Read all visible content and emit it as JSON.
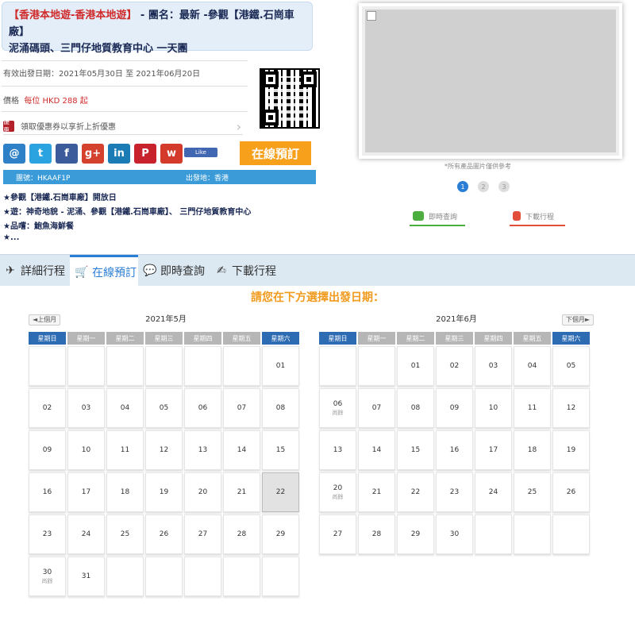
{
  "title": {
    "line1_hl": "【香港本地遊-香港本地遊】",
    "line1_rest": " - 團名：最新 -參觀【港鐵.石崗車廠】",
    "line2": "泥涌碼頭、三門仔地質教育中心 一天團"
  },
  "info": {
    "valid_period": "有效出發日期：2021年05月30日 至 2021年06月20日",
    "price_label": "價格",
    "price_value": "每位 HKD 288 起",
    "coupon_badge": "優惠",
    "coupon_text": "領取優惠券以享折上折優惠"
  },
  "share": {
    "buttons": [
      {
        "name": "email-share-icon",
        "glyph": "@",
        "color": "#2e80c7"
      },
      {
        "name": "twitter-share-icon",
        "glyph": "t",
        "color": "#2aa3e0"
      },
      {
        "name": "facebook-share-icon",
        "glyph": "f",
        "color": "#3b5b9b"
      },
      {
        "name": "googleplus-share-icon",
        "glyph": "g+",
        "color": "#d4422e"
      },
      {
        "name": "linkedin-share-icon",
        "glyph": "in",
        "color": "#1a7bb5"
      },
      {
        "name": "pinterest-share-icon",
        "glyph": "P",
        "color": "#c8232c"
      },
      {
        "name": "weibo-share-icon",
        "glyph": "w",
        "color": "#d33a2c"
      }
    ],
    "like_label": "Like"
  },
  "book_button": "在線預訂",
  "code_bar": {
    "code": "團號：HKAAF1P",
    "departure": "出發地：香港"
  },
  "features": [
    "★參觀【港鐵.石崗車廠】開放日",
    "★遊：神奇地貌 - 泥涌、參觀【港鐵.石崗車廠】、 三門仔地質教育中心",
    "★品嚐：鮑魚海鮮餐",
    "★..."
  ],
  "image_note": "*所有產品圖片僅供參考",
  "carousel_dots": [
    "1",
    "2",
    "3"
  ],
  "sub_tabs": [
    {
      "label": "即時查詢",
      "color": "#4cae3e"
    },
    {
      "label": "下載行程",
      "color": "#e24e3a"
    }
  ],
  "tabs": [
    {
      "label": "詳細行程",
      "icon": "✈"
    },
    {
      "label": "在線預訂",
      "icon": "🛒"
    },
    {
      "label": "即時查詢",
      "icon": "💬"
    },
    {
      "label": "下載行程",
      "icon": "✍"
    }
  ],
  "prompt": "請您在下方選擇出發日期：",
  "weekdays": [
    "星期日",
    "星期一",
    "星期二",
    "星期三",
    "星期四",
    "星期五",
    "星期六"
  ],
  "calendars": [
    {
      "title": "2021年5月",
      "nav_label": "◄上個月",
      "lead_blanks": 6,
      "days": [
        "01",
        "02",
        "03",
        "04",
        "05",
        "06",
        "07",
        "08",
        "09",
        "10",
        "11",
        "12",
        "13",
        "14",
        "15",
        "16",
        "17",
        "18",
        "19",
        "20",
        "21",
        "22",
        "23",
        "24",
        "25",
        "26",
        "27",
        "28",
        "29",
        "30",
        "31"
      ],
      "status": {
        "30": "尚餘"
      },
      "selected": "22"
    },
    {
      "title": "2021年6月",
      "nav_label": "下個月►",
      "lead_blanks": 2,
      "days": [
        "01",
        "02",
        "03",
        "04",
        "05",
        "06",
        "07",
        "08",
        "09",
        "10",
        "11",
        "12",
        "13",
        "14",
        "15",
        "16",
        "17",
        "18",
        "19",
        "20",
        "21",
        "22",
        "23",
        "24",
        "25",
        "26",
        "27",
        "28",
        "29",
        "30"
      ],
      "status": {
        "06": "尚餘",
        "20": "尚餘"
      },
      "selected": null
    }
  ]
}
